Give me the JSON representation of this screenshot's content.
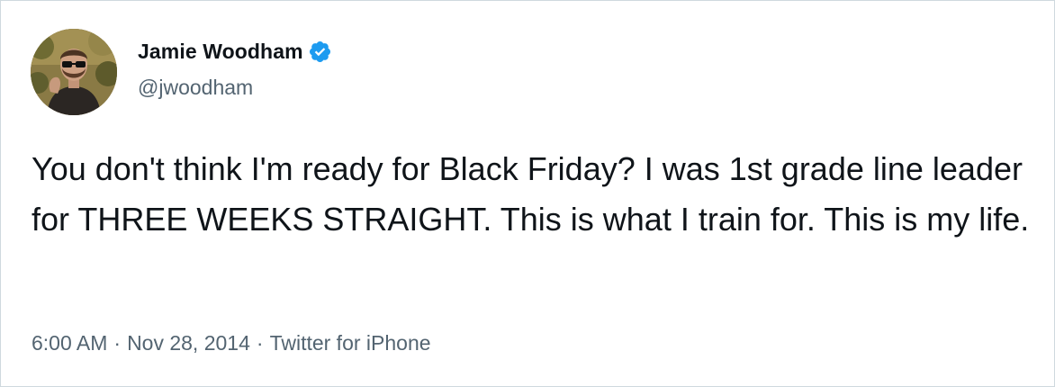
{
  "tweet": {
    "author": {
      "display_name": "Jamie Woodham",
      "handle": "@jwoodham",
      "verified": true,
      "avatar_icon": "avatar-photo"
    },
    "text": "You don't think I'm ready for Black Friday? I was 1st grade line leader for THREE WEEKS STRAIGHT. This is what I train for. This is my life.",
    "meta": {
      "time": "6:00 AM",
      "separator": "·",
      "date": "Nov 28, 2014",
      "source": "Twitter for iPhone"
    }
  },
  "colors": {
    "text_primary": "#0f1419",
    "text_secondary": "#536471",
    "verified_blue": "#1d9bf0",
    "border": "#cfd9de"
  }
}
